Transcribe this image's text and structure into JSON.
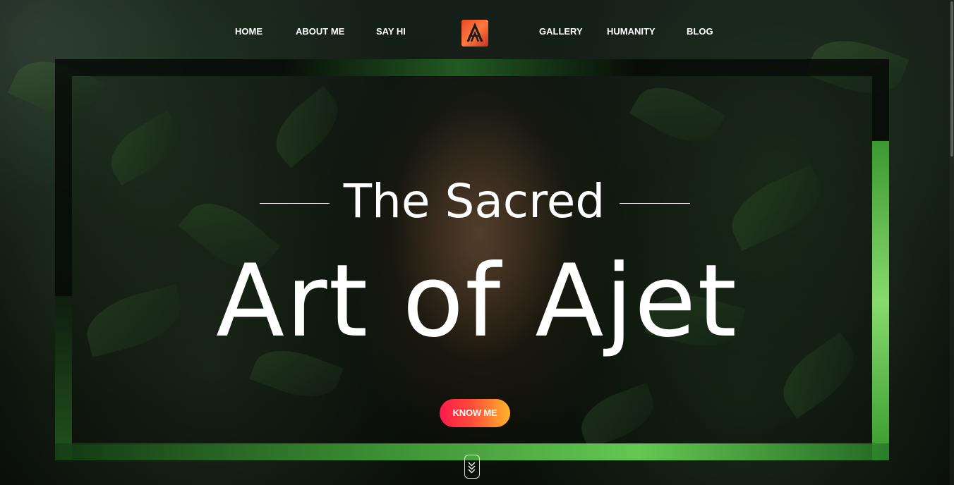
{
  "nav": {
    "items": [
      {
        "label": "HOME"
      },
      {
        "label": "ABOUT ME"
      },
      {
        "label": "SAY HI"
      },
      {
        "label": "GALLERY"
      },
      {
        "label": "HUMANITY"
      },
      {
        "label": "BLOG"
      }
    ],
    "logo_icon": "aa-monogram-logo-icon"
  },
  "hero": {
    "title_small": "The Sacred",
    "title_big": "Art of Ajet",
    "cta_label": "KNOW ME",
    "scroll_icon": "double-chevron-down-icon"
  },
  "colors": {
    "cta_start": "#ff1a4b",
    "cta_end": "#ffb52a",
    "logo": "#e8492a",
    "text": "#ffffff",
    "foliage": "#2f5a2a"
  }
}
